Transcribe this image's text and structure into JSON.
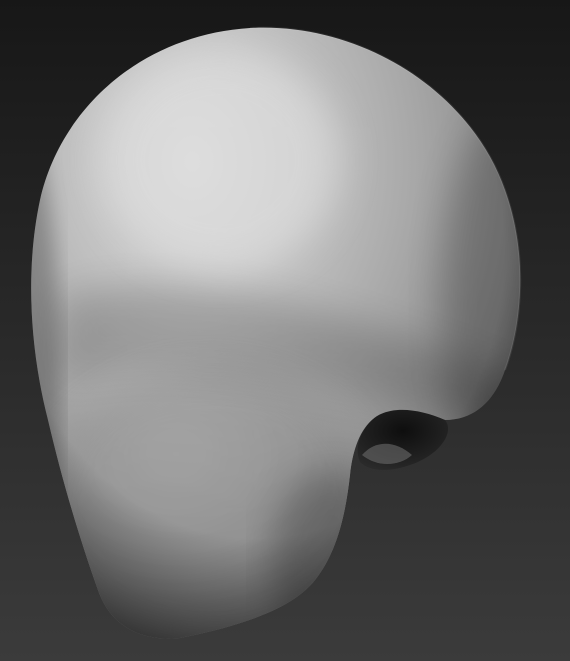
{
  "viewport": {
    "background_top": "#171717",
    "background_bottom": "#3a3a3a",
    "subject": "sculpted-head-mesh"
  },
  "mesh": {
    "material_light": "#d6d6d6",
    "material_mid": "#9e9e9e",
    "material_dark": "#4a4a4a",
    "cavity": "#1c1c1c"
  }
}
